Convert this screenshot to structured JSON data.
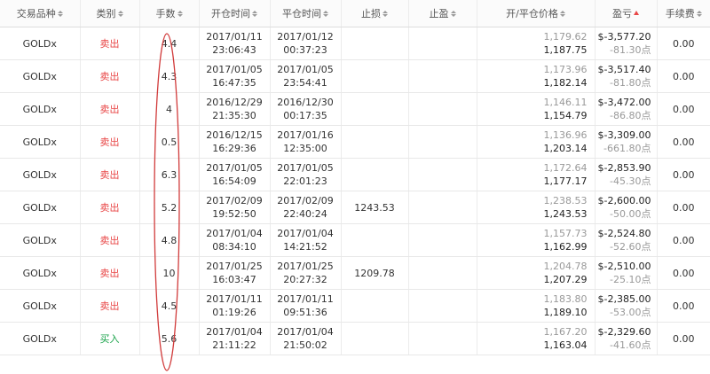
{
  "header": {
    "symbol": "交易品种",
    "type": "类别",
    "lots": "手数",
    "open_time": "开仓时间",
    "close_time": "平仓时间",
    "stop_loss": "止损",
    "take_profit": "止盈",
    "prices": "开/平仓价格",
    "profit": "盈亏",
    "fee": "手续费"
  },
  "colors": {
    "sell": "#e84646",
    "buy": "#1aa34a",
    "accent_sort": "#e84646",
    "annotation": "#d13b3b"
  },
  "rows": [
    {
      "symbol": "GOLDx",
      "type": "卖出",
      "type_kind": "sell",
      "lots": "4.4",
      "open_date": "2017/01/11",
      "open_time": "23:06:43",
      "close_date": "2017/01/12",
      "close_time": "00:37:23",
      "sl": "",
      "tp": "",
      "open_price": "1,179.62",
      "close_price": "1,187.75",
      "profit": "$-3,577.20",
      "points": "-81.30点",
      "fee": "0.00"
    },
    {
      "symbol": "GOLDx",
      "type": "卖出",
      "type_kind": "sell",
      "lots": "4.3",
      "open_date": "2017/01/05",
      "open_time": "16:47:35",
      "close_date": "2017/01/05",
      "close_time": "23:54:41",
      "sl": "",
      "tp": "",
      "open_price": "1,173.96",
      "close_price": "1,182.14",
      "profit": "$-3,517.40",
      "points": "-81.80点",
      "fee": "0.00"
    },
    {
      "symbol": "GOLDx",
      "type": "卖出",
      "type_kind": "sell",
      "lots": "4",
      "open_date": "2016/12/29",
      "open_time": "21:35:30",
      "close_date": "2016/12/30",
      "close_time": "00:17:35",
      "sl": "",
      "tp": "",
      "open_price": "1,146.11",
      "close_price": "1,154.79",
      "profit": "$-3,472.00",
      "points": "-86.80点",
      "fee": "0.00"
    },
    {
      "symbol": "GOLDx",
      "type": "卖出",
      "type_kind": "sell",
      "lots": "0.5",
      "open_date": "2016/12/15",
      "open_time": "16:29:36",
      "close_date": "2017/01/16",
      "close_time": "12:35:00",
      "sl": "",
      "tp": "",
      "open_price": "1,136.96",
      "close_price": "1,203.14",
      "profit": "$-3,309.00",
      "points": "-661.80点",
      "fee": "0.00"
    },
    {
      "symbol": "GOLDx",
      "type": "卖出",
      "type_kind": "sell",
      "lots": "6.3",
      "open_date": "2017/01/05",
      "open_time": "16:54:09",
      "close_date": "2017/01/05",
      "close_time": "22:01:23",
      "sl": "",
      "tp": "",
      "open_price": "1,172.64",
      "close_price": "1,177.17",
      "profit": "$-2,853.90",
      "points": "-45.30点",
      "fee": "0.00"
    },
    {
      "symbol": "GOLDx",
      "type": "卖出",
      "type_kind": "sell",
      "lots": "5.2",
      "open_date": "2017/02/09",
      "open_time": "19:52:50",
      "close_date": "2017/02/09",
      "close_time": "22:40:24",
      "sl": "1243.53",
      "tp": "",
      "open_price": "1,238.53",
      "close_price": "1,243.53",
      "profit": "$-2,600.00",
      "points": "-50.00点",
      "fee": "0.00"
    },
    {
      "symbol": "GOLDx",
      "type": "卖出",
      "type_kind": "sell",
      "lots": "4.8",
      "open_date": "2017/01/04",
      "open_time": "08:34:10",
      "close_date": "2017/01/04",
      "close_time": "14:21:52",
      "sl": "",
      "tp": "",
      "open_price": "1,157.73",
      "close_price": "1,162.99",
      "profit": "$-2,524.80",
      "points": "-52.60点",
      "fee": "0.00"
    },
    {
      "symbol": "GOLDx",
      "type": "卖出",
      "type_kind": "sell",
      "lots": "10",
      "open_date": "2017/01/25",
      "open_time": "16:03:47",
      "close_date": "2017/01/25",
      "close_time": "20:27:32",
      "sl": "1209.78",
      "tp": "",
      "open_price": "1,204.78",
      "close_price": "1,207.29",
      "profit": "$-2,510.00",
      "points": "-25.10点",
      "fee": "0.00"
    },
    {
      "symbol": "GOLDx",
      "type": "卖出",
      "type_kind": "sell",
      "lots": "4.5",
      "open_date": "2017/01/11",
      "open_time": "01:19:26",
      "close_date": "2017/01/11",
      "close_time": "09:51:36",
      "sl": "",
      "tp": "",
      "open_price": "1,183.80",
      "close_price": "1,189.10",
      "profit": "$-2,385.00",
      "points": "-53.00点",
      "fee": "0.00"
    },
    {
      "symbol": "GOLDx",
      "type": "买入",
      "type_kind": "buy",
      "lots": "5.6",
      "open_date": "2017/01/04",
      "open_time": "21:11:22",
      "close_date": "2017/01/04",
      "close_time": "21:50:02",
      "sl": "",
      "tp": "",
      "open_price": "1,167.20",
      "close_price": "1,163.04",
      "profit": "$-2,329.60",
      "points": "-41.60点",
      "fee": "0.00"
    }
  ]
}
